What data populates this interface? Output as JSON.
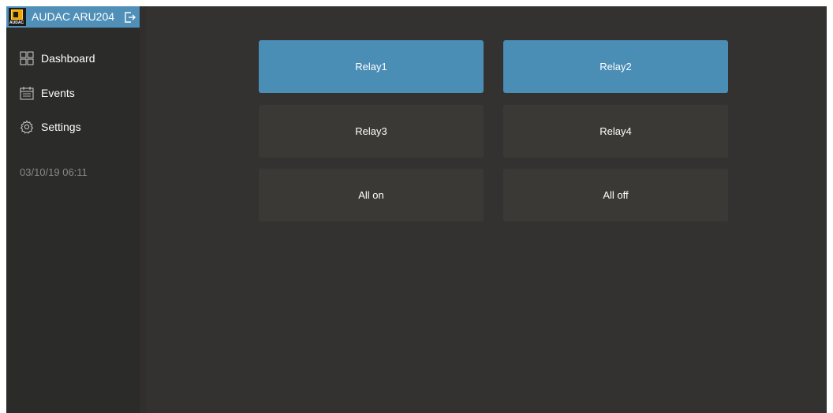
{
  "header": {
    "title": "AUDAC ARU204",
    "logo_text": "AUDAC",
    "logout_icon": "logout-icon"
  },
  "sidebar": {
    "items": [
      {
        "label": "Dashboard",
        "icon": "dashboard-grid-icon"
      },
      {
        "label": "Events",
        "icon": "calendar-icon"
      },
      {
        "label": "Settings",
        "icon": "gear-icon"
      }
    ],
    "datetime": "03/10/19 06:11"
  },
  "main": {
    "tiles": [
      {
        "label": "Relay1",
        "active": true
      },
      {
        "label": "Relay2",
        "active": true
      },
      {
        "label": "Relay3",
        "active": false
      },
      {
        "label": "Relay4",
        "active": false
      },
      {
        "label": "All on",
        "active": false
      },
      {
        "label": "All off",
        "active": false
      }
    ]
  },
  "colors": {
    "accent": "#4a8db5",
    "header_bg": "#4f8fb8",
    "sidebar_bg": "#2b2b2a",
    "main_bg": "#333230",
    "tile_inactive": "#3a3936",
    "datetime_text": "#8a8987"
  }
}
